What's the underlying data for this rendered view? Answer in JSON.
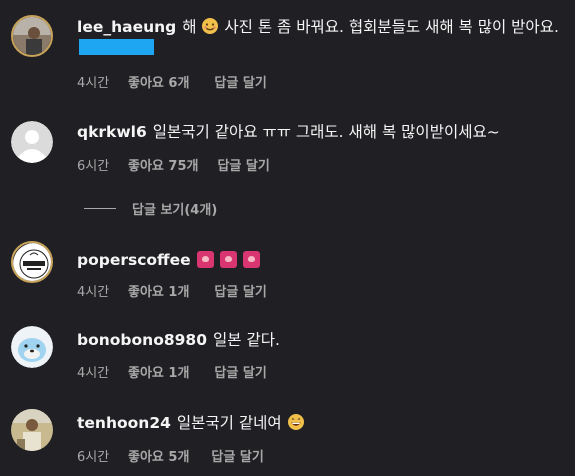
{
  "comments": [
    {
      "username": "lee_haeung",
      "text_before": "해",
      "text_after": "사진 톤 좀 바꿔요. 협회분들도 새해 복 많이 받아요.",
      "time": "4시간",
      "likes": "좋아요 6개",
      "reply": "답글 달기",
      "avatar_icon": "profile-photo-icon",
      "emoji": "smiling-face-icon"
    },
    {
      "username": "qkrkwl6",
      "text": "일본국기 같아요 ㅠㅠ 그래도. 새해 복 많이받이세요~",
      "time": "6시간",
      "likes": "좋아요 75개",
      "reply": "답글 달기",
      "avatar_icon": "default-avatar-icon"
    },
    {
      "username": "poperscoffee",
      "text": "",
      "time": "4시간",
      "likes": "좋아요 1개",
      "reply": "답글 달기",
      "avatar_icon": "poperscoffee-logo-icon",
      "stickers": [
        "heart-sticker-icon",
        "heart-sticker-icon",
        "heart-sticker-icon"
      ]
    },
    {
      "username": "bonobono8980",
      "text": "일본 같다.",
      "time": "4시간",
      "likes": "좋아요 1개",
      "reply": "답글 달기",
      "avatar_icon": "cartoon-avatar-icon"
    },
    {
      "username": "tenhoon24",
      "text": "일본국기 같네여",
      "time": "6시간",
      "likes": "좋아요 5개",
      "reply": "답글 달기",
      "avatar_icon": "profile-photo-icon",
      "emoji": "grinning-face-icon"
    }
  ],
  "view_replies": "답글 보기(4개)",
  "colors": {
    "background": "#202024",
    "text": "#f5f5f5",
    "meta": "#a8a8a8",
    "redaction": "#1ea6f2",
    "sticker": "#d9366f"
  }
}
